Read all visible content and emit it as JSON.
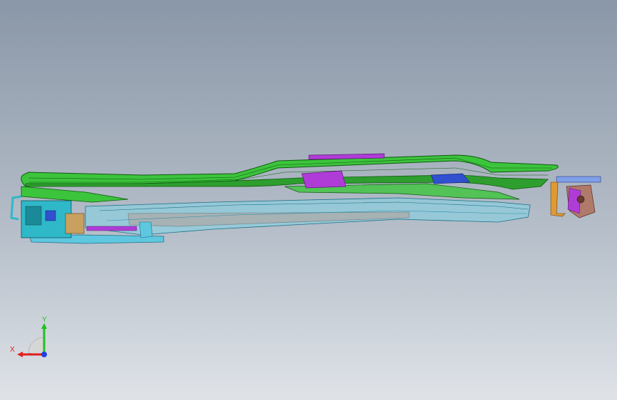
{
  "viewport": {
    "background_top": "#8a97a8",
    "background_bottom": "#dfe3e8"
  },
  "model": {
    "colors": {
      "frame_green": "#3cc43c",
      "frame_green_dark": "#1e7a1e",
      "tray_cyan": "#5fc8e0",
      "pan_salmon": "#d88a7a",
      "bracket_magenta": "#b03cd8",
      "hinge_orange": "#e09a30",
      "motor_teal": "#2fb8c8",
      "part_blue": "#3050d0"
    }
  },
  "triad": {
    "x_label": "X",
    "y_label": "Y",
    "x_color": "#e02020",
    "y_color": "#20c020",
    "z_color": "#2040e0"
  }
}
